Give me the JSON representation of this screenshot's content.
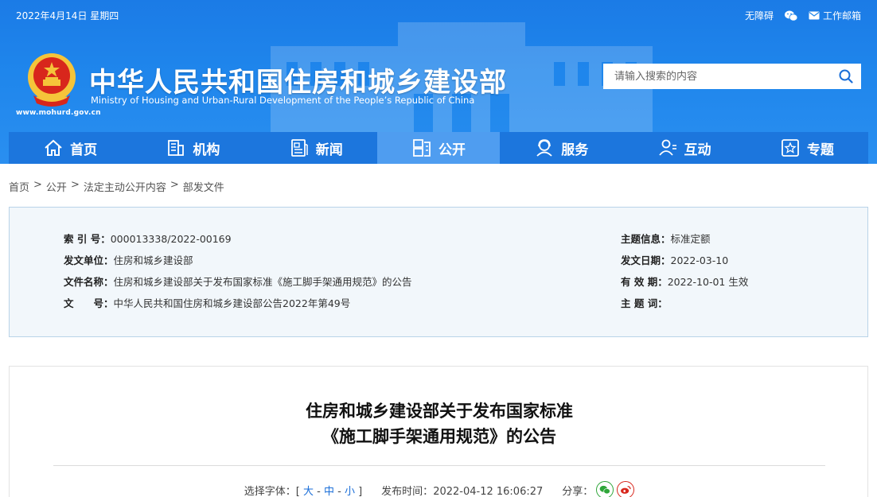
{
  "topbar": {
    "date": "2022年4月14日 星期四",
    "accessibility": "无障碍",
    "mail": "工作邮箱"
  },
  "site": {
    "url": "www.mohurd.gov.cn",
    "title": "中华人民共和国住房和城乡建设部",
    "subtitle": "Ministry of Housing and Urban-Rural Development of the People’s Republic of China"
  },
  "search": {
    "placeholder": "请输入搜索的内容"
  },
  "nav": {
    "items": [
      {
        "label": "首页",
        "icon": "home-icon"
      },
      {
        "label": "机构",
        "icon": "building-icon"
      },
      {
        "label": "新闻",
        "icon": "news-icon"
      },
      {
        "label": "公开",
        "icon": "document-icon",
        "active": true
      },
      {
        "label": "服务",
        "icon": "service-icon"
      },
      {
        "label": "互动",
        "icon": "people-icon"
      },
      {
        "label": "专题",
        "icon": "star-icon"
      }
    ]
  },
  "breadcrumb": {
    "items": [
      "首页",
      "公开",
      "法定主动公开内容",
      "部发文件"
    ],
    "sep": ">"
  },
  "info": {
    "index_k": "索 引 号：",
    "index_v": "000013338/2022-00169",
    "issuer_k": "发文单位：",
    "issuer_v": "住房和城乡建设部",
    "docname_k": "文件名称：",
    "docname_v": "住房和城乡建设部关于发布国家标准《施工脚手架通用规范》的公告",
    "docno_k": "文　　号：",
    "docno_v": "中华人民共和国住房和城乡建设部公告2022年第49号",
    "topic_k": "主题信息：",
    "topic_v": "标准定额",
    "date_k": "发文日期：",
    "date_v": "2022-03-10",
    "valid_k": "有 效 期：",
    "valid_v": "2022-10-01 生效",
    "keywords_k": "主 题 词：",
    "keywords_v": ""
  },
  "article": {
    "title_line1": "住房和城乡建设部关于发布国家标准",
    "title_line2": "《施工脚手架通用规范》的公告",
    "font_label": "选择字体：[",
    "font_large": "大",
    "font_medium": "中",
    "font_small": "小",
    "font_dash": "-",
    "font_end": "]",
    "publish_label": "发布时间：",
    "publish_time": "2022-04-12 16:06:27",
    "share_label": "分享："
  },
  "colors": {
    "header": "#1f86ec",
    "nav": "#1c76dd",
    "nav_active": "#4f9df0",
    "infobox_bg": "#f2f7fb",
    "link": "#1a6ed8"
  }
}
